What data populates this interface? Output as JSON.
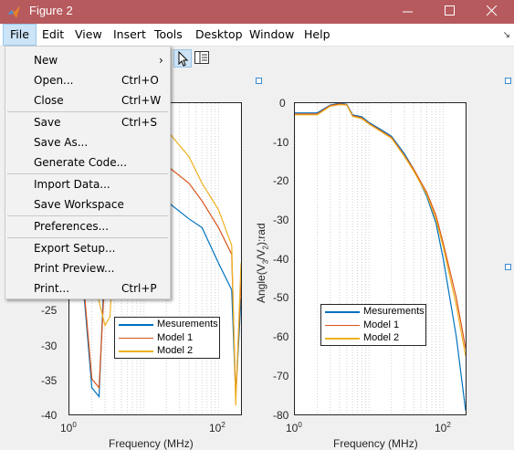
{
  "window": {
    "title": "Figure 2"
  },
  "menubar": {
    "items": [
      "File",
      "Edit",
      "View",
      "Insert",
      "Tools",
      "Desktop",
      "Window",
      "Help"
    ],
    "active": "File"
  },
  "file_menu": {
    "items": [
      {
        "label": "New",
        "shortcut": "",
        "submenu": "›"
      },
      {
        "label": "Open...",
        "shortcut": "Ctrl+O"
      },
      {
        "label": "Close",
        "shortcut": "Ctrl+W"
      },
      {
        "label": "Save",
        "shortcut": "Ctrl+S"
      },
      {
        "label": "Save As...",
        "shortcut": ""
      },
      {
        "label": "Generate Code...",
        "shortcut": ""
      },
      {
        "label": "Import Data...",
        "shortcut": ""
      },
      {
        "label": "Save Workspace",
        "shortcut": ""
      },
      {
        "label": "Preferences...",
        "shortcut": ""
      },
      {
        "label": "Export Setup...",
        "shortcut": ""
      },
      {
        "label": "Print Preview...",
        "shortcut": ""
      },
      {
        "label": "Print...",
        "shortcut": "Ctrl+P"
      }
    ]
  },
  "colors": {
    "titlebar": "#b65a5e",
    "measurements": "#0072bd",
    "model1": "#d95319",
    "model2": "#edb120"
  },
  "chart_data": [
    {
      "type": "line",
      "xlabel": "Frequency (MHz)",
      "ylabel": "",
      "x_scale": "log",
      "ylim": [
        -40,
        -5
      ],
      "yticks": [
        "-25",
        "-30",
        "-35",
        "-40"
      ],
      "xticks": [
        "10",
        "10"
      ],
      "xtick_exponents": [
        "0",
        "2"
      ],
      "legend": [
        "Mesurements",
        "Model 1",
        "Model 2"
      ],
      "legend_position": "bottom-center",
      "series": [
        {
          "name": "Mesurements",
          "x": [
            1,
            2,
            2.5,
            3,
            4,
            6,
            10,
            20,
            40,
            60,
            100,
            150,
            170,
            200
          ],
          "y": [
            -7,
            -37,
            -38,
            -22,
            -16,
            -14,
            -12,
            -16,
            -18,
            -19,
            -23,
            -26,
            -38,
            -27
          ]
        },
        {
          "name": "Model 1",
          "x": [
            1,
            2,
            2.5,
            3,
            4,
            6,
            10,
            20,
            40,
            60,
            100,
            150,
            170,
            200
          ],
          "y": [
            -7,
            -36,
            -37,
            -24,
            -15,
            -12,
            -10,
            -12,
            -14,
            -16,
            -19,
            -22,
            -38,
            -25
          ]
        },
        {
          "name": "Model 2",
          "x": [
            1,
            2,
            3,
            3.5,
            4,
            6,
            10,
            20,
            40,
            60,
            100,
            150,
            170,
            200
          ],
          "y": [
            -7,
            -24,
            -30,
            -29,
            -20,
            -12,
            -9,
            -8,
            -11,
            -14,
            -17,
            -21,
            -39,
            -23
          ]
        }
      ]
    },
    {
      "type": "line",
      "xlabel": "Frequency (MHz)",
      "ylabel": "Angle(V3/V2):rad",
      "ylabel_parts": {
        "pre": "Angle(V",
        "sub1": "3",
        "mid": "/V",
        "sub2": "2",
        "post": "):rad"
      },
      "x_scale": "log",
      "ylim": [
        -80,
        0
      ],
      "yticks": [
        "0",
        "-10",
        "-20",
        "-30",
        "-40",
        "-50",
        "-60",
        "-70",
        "-80"
      ],
      "xticks": [
        "10",
        "10"
      ],
      "xtick_exponents": [
        "0",
        "2"
      ],
      "legend": [
        "Mesurements",
        "Model 1",
        "Model 2"
      ],
      "legend_position": "bottom-center",
      "series": [
        {
          "name": "Mesurements",
          "x": [
            1,
            2,
            3,
            4,
            5,
            6,
            8,
            10,
            15,
            20,
            30,
            40,
            60,
            80,
            100,
            150,
            200
          ],
          "y": [
            -2.5,
            -2.5,
            -0.5,
            0,
            -0.3,
            -3,
            -3.5,
            -5,
            -7,
            -8.5,
            -13,
            -17,
            -24,
            -31,
            -40,
            -60,
            -79
          ]
        },
        {
          "name": "Model 1",
          "x": [
            1,
            2,
            3,
            4,
            5,
            6,
            8,
            10,
            15,
            20,
            30,
            40,
            60,
            80,
            100,
            150,
            200
          ],
          "y": [
            -2.8,
            -2.8,
            -0.6,
            -0.2,
            -0.4,
            -3.2,
            -3.8,
            -5.2,
            -7.3,
            -8.8,
            -13.5,
            -17,
            -23,
            -29,
            -36,
            -50,
            -63
          ]
        },
        {
          "name": "Model 2",
          "x": [
            1,
            2,
            3,
            4,
            5,
            6,
            8,
            10,
            15,
            20,
            30,
            40,
            60,
            80,
            100,
            150,
            200
          ],
          "y": [
            -3,
            -3,
            -0.8,
            -0.4,
            -0.5,
            -3.4,
            -4,
            -5.4,
            -7.5,
            -9,
            -13.7,
            -17.5,
            -23.5,
            -30,
            -37,
            -52,
            -65
          ]
        }
      ]
    }
  ]
}
